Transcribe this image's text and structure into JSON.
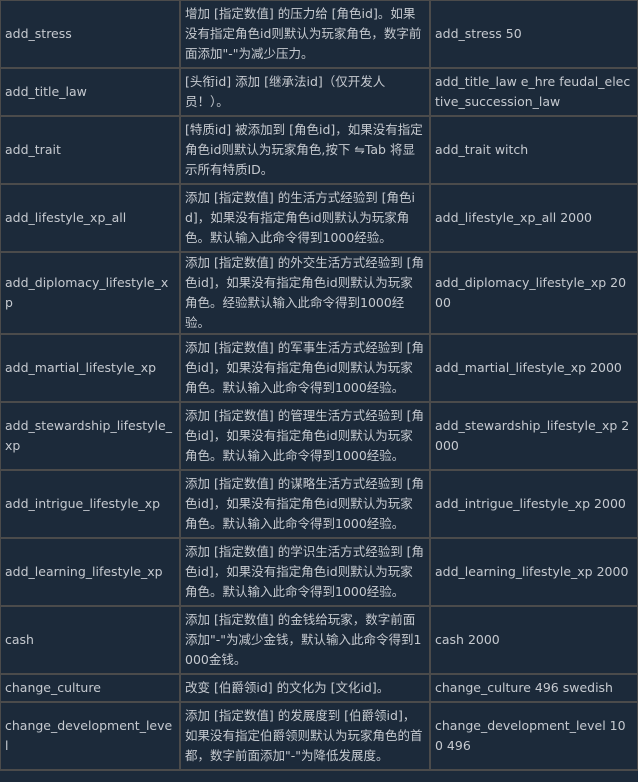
{
  "rows": [
    {
      "command": "add_stress",
      "description": "增加 [指定数值] 的压力给 [角色id]。如果没有指定角色id则默认为玩家角色，数字前面添加\"-\"为减少压力。",
      "example": "add_stress 50"
    },
    {
      "command": "add_title_law",
      "description": "[头衔id] 添加 [继承法id]（仅开发人员！）。",
      "example": "add_title_law e_hre feudal_elective_succession_law"
    },
    {
      "command": "add_trait",
      "description": "[特质id] 被添加到 [角色id]，如果没有指定角色id则默认为玩家角色,按下 ⇋Tab 将显示所有特质ID。",
      "example": "add_trait witch"
    },
    {
      "command": "add_lifestyle_xp_all",
      "description": "添加 [指定数值] 的生活方式经验到 [角色id]，如果没有指定角色id则默认为玩家角色。默认输入此命令得到1000经验。",
      "example": "add_lifestyle_xp_all 2000"
    },
    {
      "command": "add_diplomacy_lifestyle_xp",
      "description": "添加 [指定数值] 的外交生活方式经验到 [角色id]，如果没有指定角色id则默认为玩家角色。经验默认输入此命令得到1000经验。",
      "example": "add_diplomacy_lifestyle_xp 2000"
    },
    {
      "command": "add_martial_lifestyle_xp",
      "description": "添加 [指定数值] 的军事生活方式经验到 [角色id]，如果没有指定角色id则默认为玩家角色。默认输入此命令得到1000经验。",
      "example": "add_martial_lifestyle_xp 2000"
    },
    {
      "command": "add_stewardship_lifestyle_xp",
      "description": "添加 [指定数值] 的管理生活方式经验到 [角色id]，如果没有指定角色id则默认为玩家角色。默认输入此命令得到1000经验。",
      "example": "add_stewardship_lifestyle_xp 2000"
    },
    {
      "command": "add_intrigue_lifestyle_xp",
      "description": "添加 [指定数值] 的谋略生活方式经验到 [角色id]，如果没有指定角色id则默认为玩家角色。默认输入此命令得到1000经验。",
      "example": "add_intrigue_lifestyle_xp 2000"
    },
    {
      "command": "add_learning_lifestyle_xp",
      "description": "添加 [指定数值] 的学识生活方式经验到 [角色id]，如果没有指定角色id则默认为玩家角色。默认输入此命令得到1000经验。",
      "example": "add_learning_lifestyle_xp 2000"
    },
    {
      "command": "cash",
      "description": "添加 [指定数值] 的金钱给玩家，数字前面添加\"-\"为减少金钱，默认输入此命令得到1000金钱。",
      "example": "cash 2000"
    },
    {
      "command": "change_culture",
      "description": "改变 [伯爵领id] 的文化为 [文化id]。",
      "example": "change_culture 496 swedish"
    },
    {
      "command": "change_development_level",
      "description": "添加 [指定数值] 的发展度到 [伯爵领id]，如果没有指定伯爵领则默认为玩家角色的首都，数字前面添加\"-\"为降低发展度。",
      "example": "change_development_level 100 496"
    }
  ]
}
